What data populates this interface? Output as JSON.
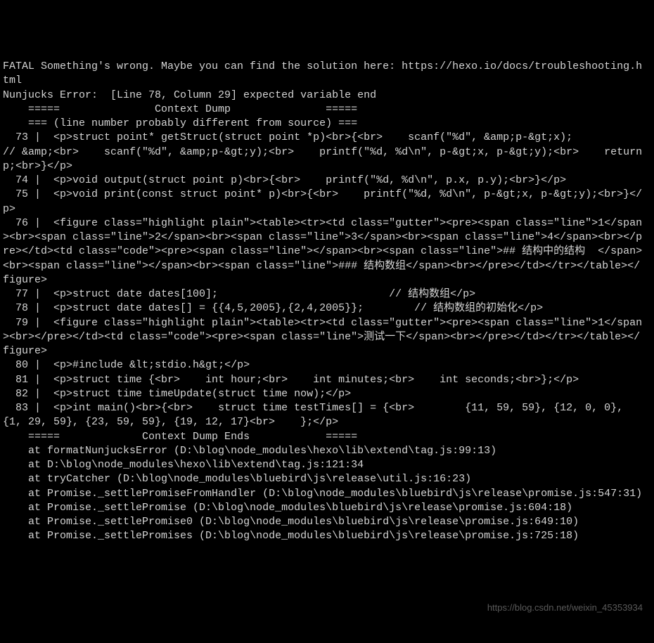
{
  "terminal": {
    "lines": [
      "FATAL Something's wrong. Maybe you can find the solution here: https://hexo.io/docs/troubleshooting.html",
      "Nunjucks Error:  [Line 78, Column 29] expected variable end",
      "    =====               Context Dump               =====",
      "    === (line number probably different from source) ===",
      "  73 |  <p>struct point* getStruct(struct point *p)<br>{<br>    scanf(\"%d\", &amp;p-&gt;x);                     // &amp;<br>    scanf(\"%d\", &amp;p-&gt;y);<br>    printf(\"%d, %d\\n\", p-&gt;x, p-&gt;y);<br>    return p;<br>}</p>",
      "  74 |  <p>void output(struct point p)<br>{<br>    printf(\"%d, %d\\n\", p.x, p.y);<br>}</p>",
      "  75 |  <p>void print(const struct point* p)<br>{<br>    printf(\"%d, %d\\n\", p-&gt;x, p-&gt;y);<br>}</p>",
      "  76 |  <figure class=\"highlight plain\"><table><tr><td class=\"gutter\"><pre><span class=\"line\">1</span><br><span class=\"line\">2</span><br><span class=\"line\">3</span><br><span class=\"line\">4</span><br></pre></td><td class=\"code\"><pre><span class=\"line\"></span><br><span class=\"line\">## 结构中的结构  </span><br><span class=\"line\"></span><br><span class=\"line\">### 结构数组</span><br></pre></td></tr></table></figure>",
      "  77 |  <p>struct date dates[100];                           // 结构数组</p>",
      "  78 |  <p>struct date dates[] = {{4,5,2005},{2,4,2005}};        // 结构数组的初始化</p>",
      "  79 |  <figure class=\"highlight plain\"><table><tr><td class=\"gutter\"><pre><span class=\"line\">1</span><br></pre></td><td class=\"code\"><pre><span class=\"line\">测试一下</span><br></pre></td></tr></table></figure>",
      "  80 |  <p>#include &lt;stdio.h&gt;</p>",
      "  81 |  <p>struct time {<br>    int hour;<br>    int minutes;<br>    int seconds;<br>};</p>",
      "  82 |  <p>struct time timeUpdate(struct time now);</p>",
      "  83 |  <p>int main()<br>{<br>    struct time testTimes[] = {<br>        {11, 59, 59}, {12, 0, 0}, {1, 29, 59}, {23, 59, 59}, {19, 12, 17}<br>    };</p>",
      "    =====             Context Dump Ends            =====",
      "    at formatNunjucksError (D:\\blog\\node_modules\\hexo\\lib\\extend\\tag.js:99:13)",
      "    at D:\\blog\\node_modules\\hexo\\lib\\extend\\tag.js:121:34",
      "    at tryCatcher (D:\\blog\\node_modules\\bluebird\\js\\release\\util.js:16:23)",
      "    at Promise._settlePromiseFromHandler (D:\\blog\\node_modules\\bluebird\\js\\release\\promise.js:547:31)",
      "    at Promise._settlePromise (D:\\blog\\node_modules\\bluebird\\js\\release\\promise.js:604:18)",
      "    at Promise._settlePromise0 (D:\\blog\\node_modules\\bluebird\\js\\release\\promise.js:649:10)",
      "    at Promise._settlePromises (D:\\blog\\node_modules\\bluebird\\js\\release\\promise.js:725:18)"
    ]
  },
  "watermark": "https://blog.csdn.net/weixin_45353934"
}
